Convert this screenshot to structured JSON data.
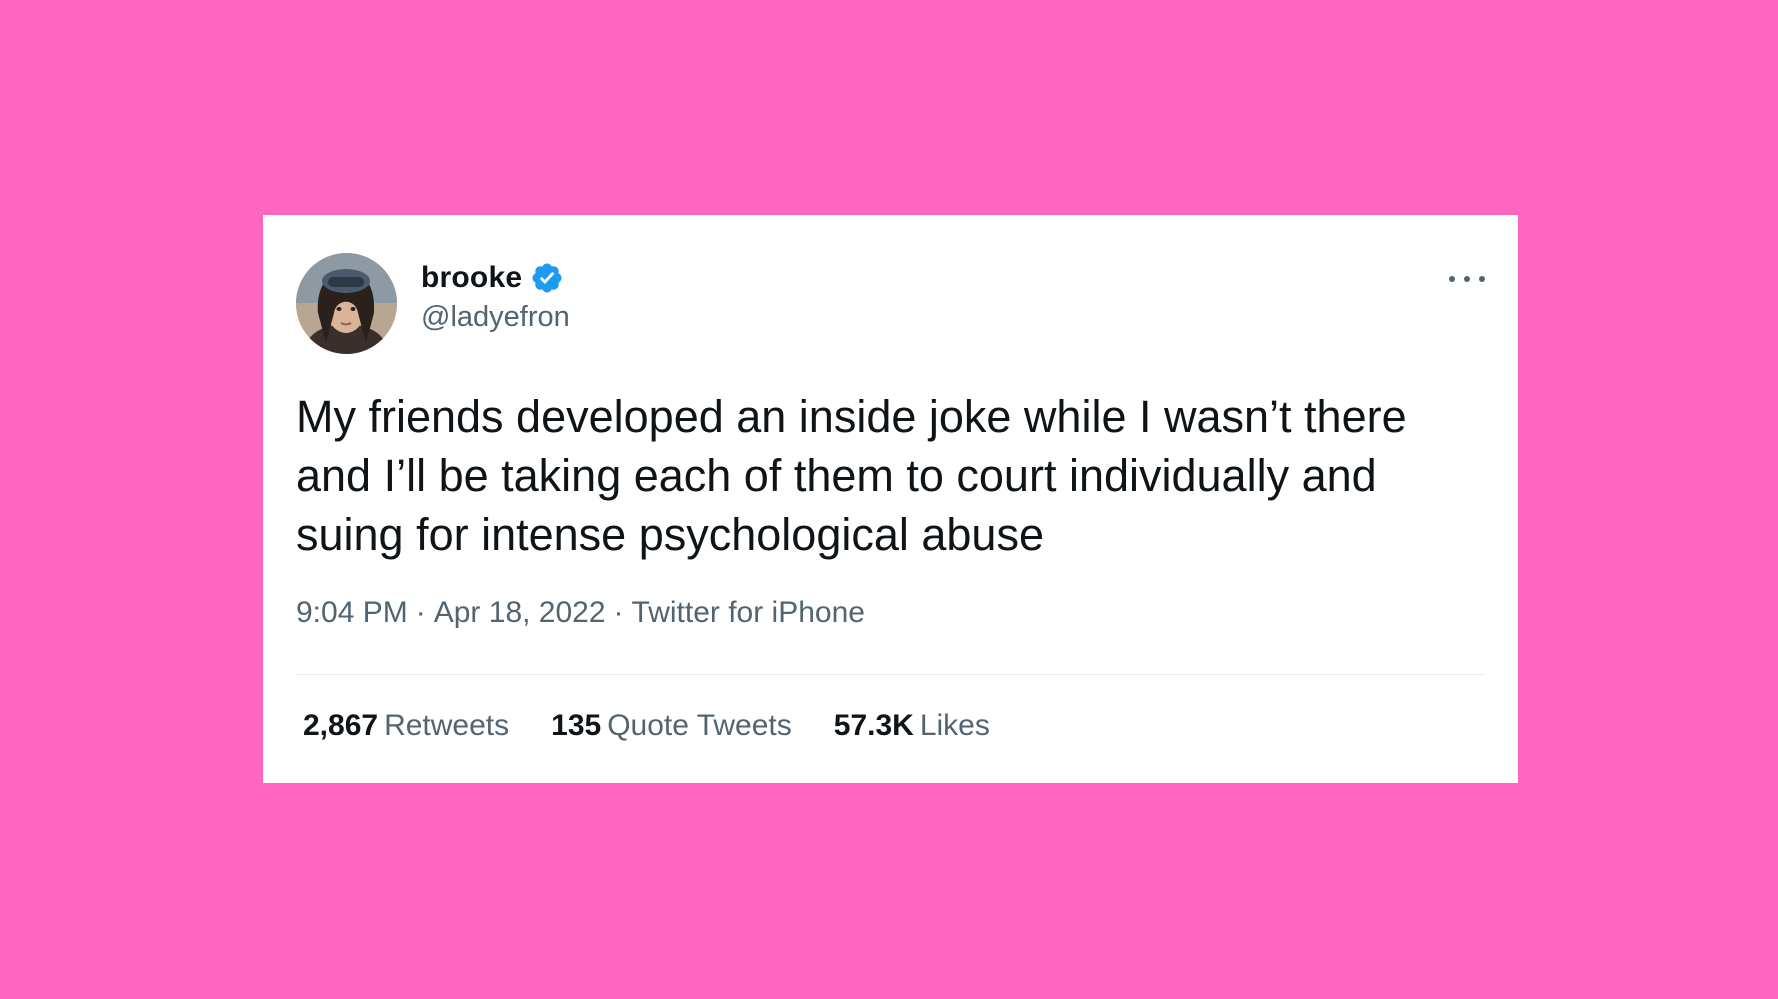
{
  "colors": {
    "background": "#ff66c0",
    "card": "#ffffff",
    "verified": "#1d9bf0",
    "primary_text": "#0f1419",
    "secondary_text": "#536471"
  },
  "tweet": {
    "author": {
      "display_name": "brooke",
      "handle": "@ladyefron",
      "verified_icon": "verified-badge-icon",
      "avatar": "profile-photo"
    },
    "more_icon": "more-options-icon",
    "text": "My friends developed an inside joke while I wasn’t there and I’ll be taking each of them to court individually and suing for intense psychological abuse",
    "time": "9:04 PM",
    "separator": "·",
    "date": "Apr 18, 2022",
    "source": "Twitter for iPhone",
    "stats": {
      "retweets": {
        "value": "2,867",
        "label": "Retweets"
      },
      "quote_tweets": {
        "value": "135",
        "label": "Quote Tweets"
      },
      "likes": {
        "value": "57.3K",
        "label": "Likes"
      }
    }
  }
}
